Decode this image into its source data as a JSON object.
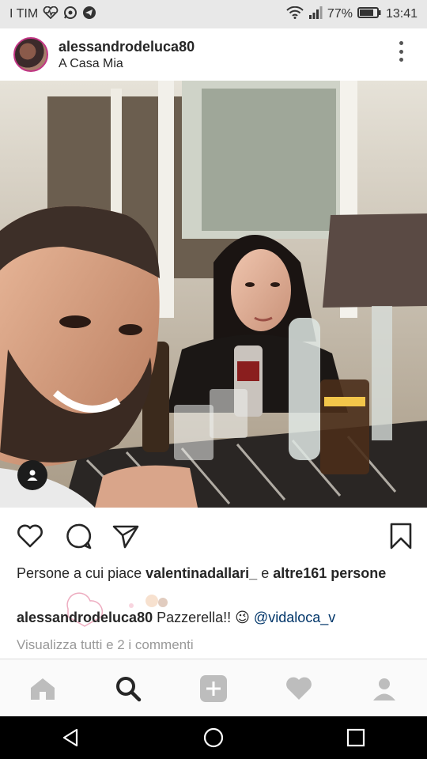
{
  "status_bar": {
    "carrier": "I TIM",
    "battery": "77%",
    "time": "13:41",
    "icons": [
      "heartbeat-icon",
      "whatsapp-icon",
      "telegram-icon",
      "wifi-icon",
      "signal-icon",
      "battery-icon"
    ]
  },
  "post": {
    "username": "alessandrodeluca80",
    "location": "A Casa Mia",
    "likes": {
      "prefix": "Persone a cui piace ",
      "liker": "valentinadallari_",
      "joiner": " e ",
      "others": "altre161 persone"
    },
    "caption": {
      "user": "alessandrodeluca80",
      "text": " Pazzerella!! ",
      "emoji": "😉",
      "mention": "@vidaloca_v"
    },
    "view_comments": "Visualizza tutti e 2 i commenti"
  },
  "bottom_nav": [
    "home-icon",
    "search-icon",
    "add-icon",
    "activity-heart-icon",
    "profile-icon"
  ],
  "colors": {
    "status_bar_bg": "#e8e8e8",
    "text": "#262626",
    "mention": "#003569",
    "muted": "#999999",
    "nav_bg": "#fafafa"
  }
}
